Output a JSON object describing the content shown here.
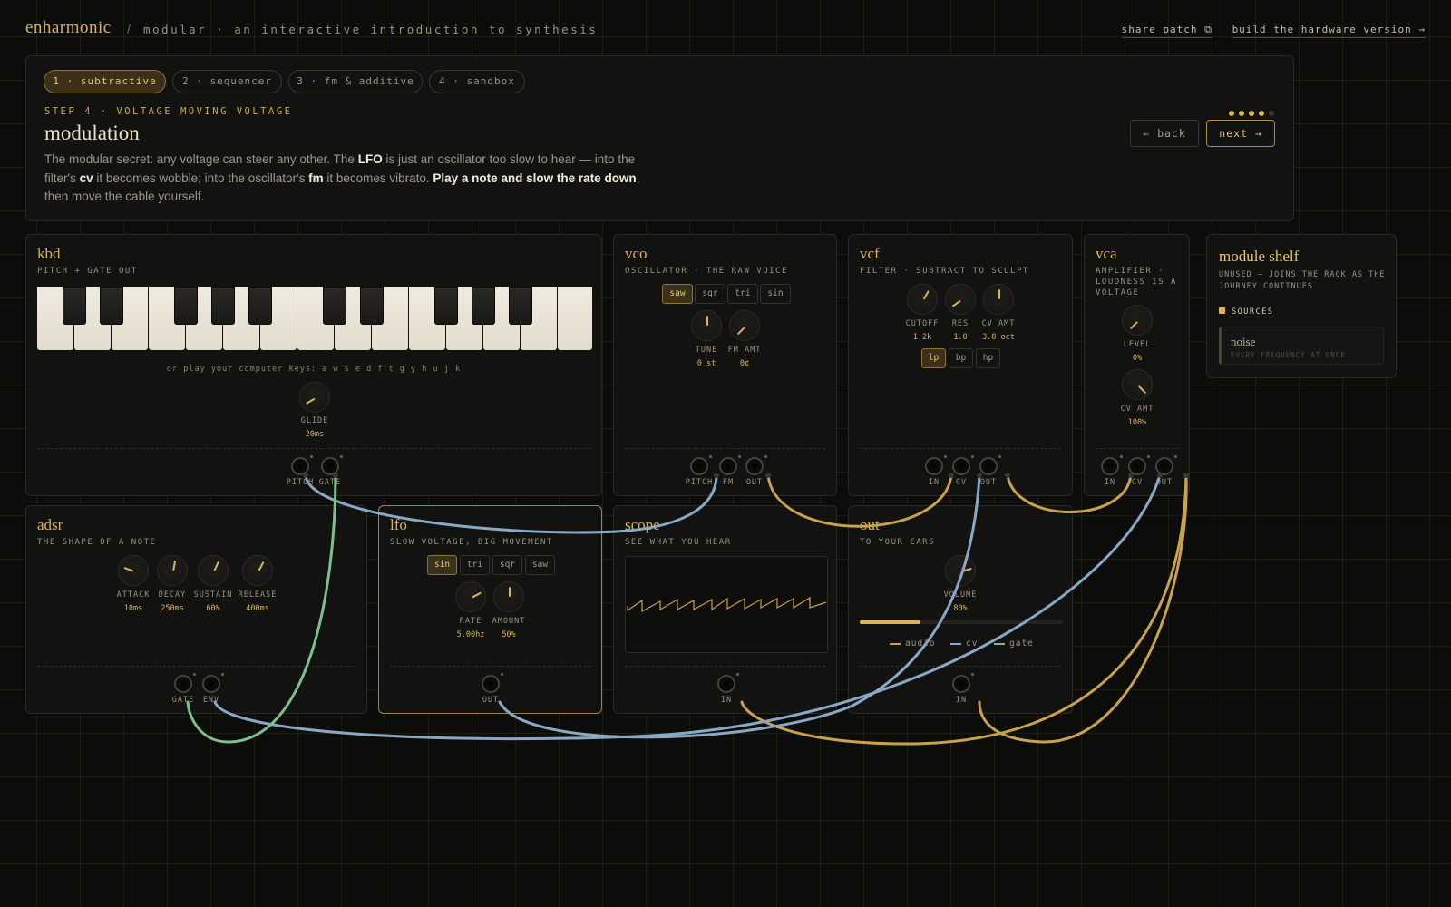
{
  "header": {
    "brand": "enharmonic",
    "separator": "/",
    "breadcrumb": "modular · an interactive introduction to synthesis",
    "share_label": "share patch ⧉",
    "build_label": "build the hardware version →"
  },
  "lesson": {
    "tabs": [
      {
        "label": "1 · subtractive",
        "active": true
      },
      {
        "label": "2 · sequencer",
        "active": false
      },
      {
        "label": "3 · fm & additive",
        "active": false
      },
      {
        "label": "4 · sandbox",
        "active": false
      }
    ],
    "step_label": "STEP 4 · VOLTAGE MOVING VOLTAGE",
    "title": "modulation",
    "body": {
      "p1": "The modular secret: any voltage can steer any other. The ",
      "b1": "LFO",
      "p2": " is just an oscillator too slow to hear — into the filter's ",
      "b2": "cv",
      "p3": " it becomes wobble; into the oscillator's ",
      "b3": "fm",
      "p4": " it becomes vibrato. ",
      "b4": "Play a note and slow the rate down",
      "p5": ", then move the cable yourself."
    },
    "progress": {
      "current": 4,
      "total": 5
    },
    "back_label": "← back",
    "next_label": "next →"
  },
  "modules": {
    "kbd": {
      "title": "kbd",
      "subtitle": "PITCH + GATE OUT",
      "hint": "or play your computer keys: a w s e d f t g y h u j k",
      "glide": {
        "label": "GLIDE",
        "value": "20ms"
      },
      "jacks": [
        "PITCH",
        "GATE"
      ]
    },
    "vco": {
      "title": "vco",
      "subtitle": "OSCILLATOR · THE RAW VOICE",
      "waves": [
        "saw",
        "sqr",
        "tri",
        "sin"
      ],
      "selected_wave": "saw",
      "tune": {
        "label": "TUNE",
        "value": "0 st"
      },
      "fm_amt": {
        "label": "FM AMT",
        "value": "0¢"
      },
      "jacks": [
        "PITCH",
        "FM",
        "OUT"
      ]
    },
    "vcf": {
      "title": "vcf",
      "subtitle": "FILTER · SUBTRACT TO SCULPT",
      "cutoff": {
        "label": "CUTOFF",
        "value": "1.2k"
      },
      "res": {
        "label": "RES",
        "value": "1.0"
      },
      "cv_amt": {
        "label": "CV AMT",
        "value": "3.0 oct"
      },
      "modes": [
        "lp",
        "bp",
        "hp"
      ],
      "selected_mode": "lp",
      "jacks": [
        "IN",
        "CV",
        "OUT"
      ]
    },
    "vca": {
      "title": "vca",
      "subtitle": "AMPLIFIER · LOUDNESS IS A VOLTAGE",
      "level": {
        "label": "LEVEL",
        "value": "0%"
      },
      "cv_amt": {
        "label": "CV AMT",
        "value": "100%"
      },
      "jacks": [
        "IN",
        "CV",
        "OUT"
      ]
    },
    "adsr": {
      "title": "adsr",
      "subtitle": "THE SHAPE OF A NOTE",
      "attack": {
        "label": "ATTACK",
        "value": "10ms"
      },
      "decay": {
        "label": "DECAY",
        "value": "250ms"
      },
      "sustain": {
        "label": "SUSTAIN",
        "value": "60%"
      },
      "release": {
        "label": "RELEASE",
        "value": "400ms"
      },
      "jacks": [
        "GATE",
        "ENV"
      ]
    },
    "lfo": {
      "title": "lfo",
      "subtitle": "SLOW VOLTAGE, BIG MOVEMENT",
      "waves": [
        "sin",
        "tri",
        "sqr",
        "saw"
      ],
      "selected_wave": "sin",
      "rate": {
        "label": "RATE",
        "value": "5.00hz"
      },
      "amount": {
        "label": "AMOUNT",
        "value": "50%"
      },
      "jacks": [
        "OUT"
      ]
    },
    "scope": {
      "title": "scope",
      "subtitle": "SEE WHAT YOU HEAR",
      "jacks": [
        "IN"
      ]
    },
    "out": {
      "title": "out",
      "subtitle": "TO YOUR EARS",
      "volume": {
        "label": "VOLUME",
        "value": "80%"
      },
      "meter_level": 0.3,
      "legend": [
        {
          "label": "audio",
          "color": "#c9a24e"
        },
        {
          "label": "cv",
          "color": "#8aa8c6"
        },
        {
          "label": "gate",
          "color": "#7fbf8f"
        }
      ],
      "jacks": [
        "IN"
      ]
    }
  },
  "shelf": {
    "title": "module shelf",
    "subtitle": "UNUSED — JOINS THE RACK AS THE JOURNEY CONTINUES",
    "section": "SOURCES",
    "items": [
      {
        "name": "noise",
        "desc": "EVERY FREQUENCY AT ONCE"
      }
    ]
  },
  "colors": {
    "accent": "#d9b45a",
    "audio_cable": "#c9a24e",
    "cv_cable": "#8aa8c6",
    "gate_cable": "#7fbf8f",
    "background": "#0c0c0a"
  }
}
